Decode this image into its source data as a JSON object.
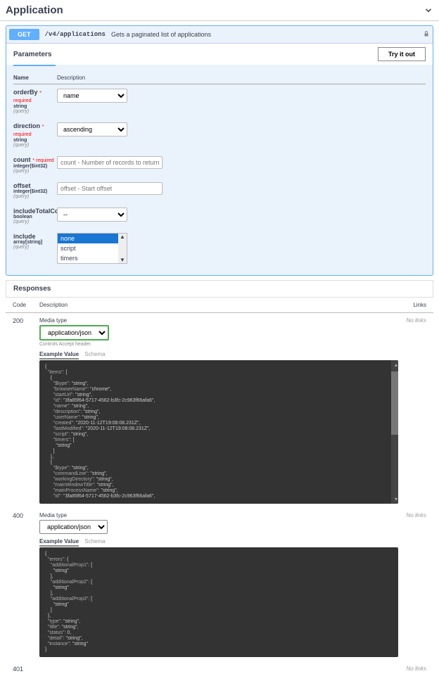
{
  "section": {
    "title": "Application"
  },
  "op": {
    "method": "GET",
    "path": "/v4/applications",
    "summary": "Gets a paginated list of applications"
  },
  "paramsHeader": "Parameters",
  "tryIt": "Try it out",
  "tableHead": {
    "name": "Name",
    "desc": "Description"
  },
  "params": {
    "orderBy": {
      "name": "orderBy",
      "required": "* required",
      "type": "string",
      "loc": "(query)",
      "value": "name"
    },
    "direction": {
      "name": "direction",
      "required": "* required",
      "type": "string",
      "loc": "(query)",
      "value": "ascending"
    },
    "count": {
      "name": "count",
      "required": "* required",
      "type": "integer($int32)",
      "loc": "(query)",
      "placeholder": "count - Number of records to return"
    },
    "offset": {
      "name": "offset",
      "type": "integer($int32)",
      "loc": "(query)",
      "placeholder": "offset - Start offset"
    },
    "includeTotalCount": {
      "name": "includeTotalCount",
      "type": "boolean",
      "loc": "(query)",
      "value": "--"
    },
    "include": {
      "name": "include",
      "type": "array[string]",
      "loc": "(query)",
      "opts": [
        "none",
        "script",
        "timers"
      ]
    }
  },
  "responsesHeader": "Responses",
  "respHead": {
    "code": "Code",
    "desc": "Description",
    "links": "Links"
  },
  "mediaTypeLabel": "Media type",
  "mediaType": "application/json",
  "controlsNote": "Controls Accept header.",
  "noLinks": "No links",
  "tabs": {
    "example": "Example Value",
    "schema": "Schema"
  },
  "code200": "200",
  "code400": "400",
  "code401": "401",
  "example200": "{\n  \"items\": [\n    {\n      \"$type\": \"string\",\n      \"browserName\": \"chrome\",\n      \"startUrl\": \"string\",\n      \"id\": \"3fa85f64-5717-4562-b3fc-2c963f66afa6\",\n      \"name\": \"string\",\n      \"description\": \"string\",\n      \"userName\": \"string\",\n      \"created\": \"2020-11-12T19:08:08.231Z\",\n      \"lastModified\": \"2020-11-12T19:08:08.231Z\",\n      \"script\": \"string\",\n      \"timers\": [\n        \"string\"\n      ]\n    },\n    {\n      \"$type\": \"string\",\n      \"commandLine\": \"string\",\n      \"workingDirectory\": \"string\",\n      \"mainWindowTitle\": \"string\",\n      \"mainProcessName\": \"string\",\n      \"id\": \"3fa85f64-5717-4562-b3fc-2c963f66afa6\",",
  "example400": "{\n  \"errors\": {\n    \"additionalProp1\": [\n      \"string\"\n    ],\n    \"additionalProp2\": [\n      \"string\"\n    ],\n    \"additionalProp3\": [\n      \"string\"\n    ]\n  },\n  \"type\": \"string\",\n  \"title\": \"string\",\n  \"status\": 0,\n  \"detail\": \"string\",\n  \"instance\": \"string\"\n}"
}
